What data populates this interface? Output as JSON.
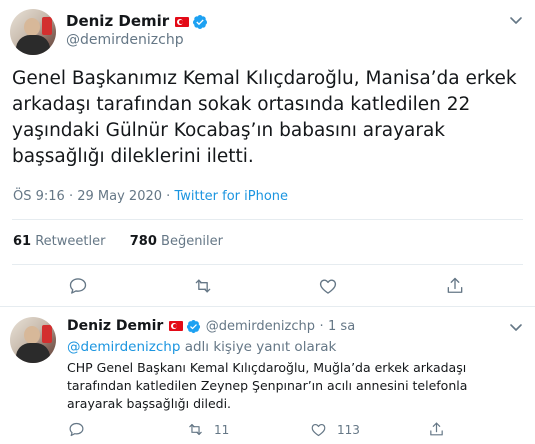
{
  "main_tweet": {
    "author": {
      "name": "Deniz Demir",
      "handle": "@demirdenizchp"
    },
    "text": "Genel Başkanımız Kemal Kılıçdaroğlu, Manisa’da erkek arkadaşı tarafından sokak ortasında katledilen 22 yaşındaki Gülnür Kocabaş’ın babasını arayarak başsağlığı dileklerini iletti.",
    "time": "ÖS 9:16",
    "date": "29 May 2020",
    "separator": "·",
    "source": "Twitter for iPhone",
    "stats": {
      "retweets_count": "61",
      "retweets_label": "Retweetler",
      "likes_count": "780",
      "likes_label": "Beğeniler"
    }
  },
  "reply_tweet": {
    "author": {
      "name": "Deniz Demir",
      "handle": "@demirdenizchp"
    },
    "age_separator": "·",
    "age": "1 sa",
    "replying_to": "@demirdenizchp",
    "replying_suffix": "adlı kişiye yanıt olarak",
    "text": "CHP Genel Başkanı Kemal Kılıçdaroğlu, Muğla’da erkek arkadaşı tarafından katledilen Zeynep Şenpınar’ın acılı annesini telefonla arayarak başsağlığı diledi.",
    "retweets": "11",
    "likes": "113"
  },
  "colors": {
    "accent": "#1da1f2",
    "link": "#1b95e0",
    "muted": "#657786",
    "text": "#14171a",
    "divider": "#e6ecf0"
  }
}
